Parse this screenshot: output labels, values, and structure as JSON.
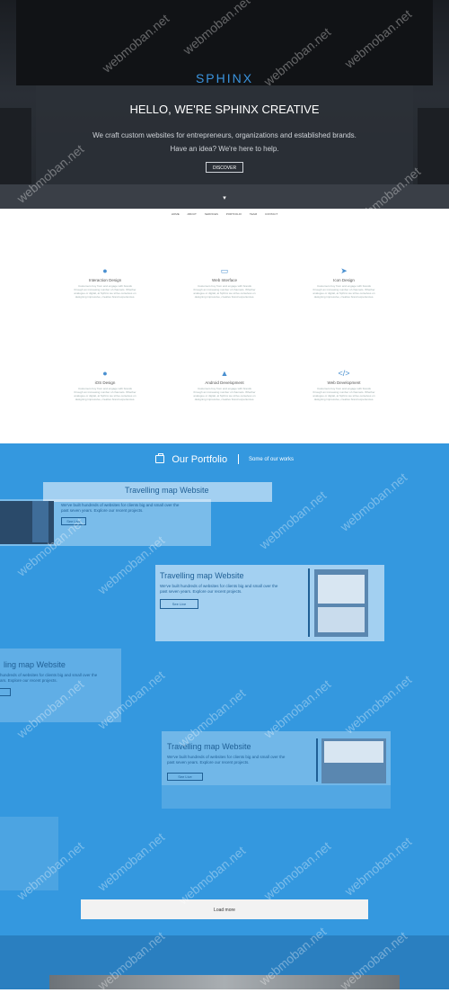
{
  "hero": {
    "logo": "SPHINX",
    "title": "HELLO, WE'RE SPHINX CREATIVE",
    "subtitle_line1": "We craft custom websites for entrepreneurs, organizations and established brands.",
    "subtitle_line2": "Have an idea? We're here to help.",
    "discover_label": "DISCOVER",
    "scroll_icon": "mouse-scroll-icon"
  },
  "nav": {
    "items": [
      "HOME",
      "ABOUT",
      "SERVICES",
      "PORTFOLIO",
      "TEAM",
      "CONTACT"
    ]
  },
  "services": [
    {
      "icon": "lightbulb-icon",
      "glyph": "💡",
      "title": "Interaction Design",
      "desc": "Customers buy from and engage with brands through an increasing number of channels. Whether analogue or digital, at Sphinx we strive ourselves on designing impressive, creative brand experiences."
    },
    {
      "icon": "monitor-icon",
      "glyph": "▭",
      "title": "Web Interface",
      "desc": "Customers buy from and engage with brands through an increasing number of channels. Whether analogue or digital, at Sphinx we strive ourselves on designing impressive, creative brand experiences."
    },
    {
      "icon": "rocket-icon",
      "glyph": "🚀",
      "title": "Icon Design",
      "desc": "Customers buy from and engage with brands through an increasing number of channels. Whether analogue or digital, at Sphinx we strive ourselves on designing impressive, creative brand experiences."
    },
    {
      "icon": "apple-icon",
      "glyph": "",
      "title": "iOS Design",
      "desc": "Customers buy from and engage with brands through an increasing number of channels. Whether analogue or digital, at Sphinx we strive ourselves on designing impressive, creative brand experiences."
    },
    {
      "icon": "android-icon",
      "glyph": "🤖",
      "title": "Android Development",
      "desc": "Customers buy from and engage with brands through an increasing number of channels. Whether analogue or digital, at Sphinx we strive ourselves on designing impressive, creative brand experiences."
    },
    {
      "icon": "code-icon",
      "glyph": "</>",
      "title": "Web Development",
      "desc": "Customers buy from and engage with brands through an increasing number of channels. Whether analogue or digital, at Sphinx we strive ourselves on designing impressive, creative brand experiences."
    }
  ],
  "portfolio": {
    "heading": "Our Portfolio",
    "subheading": "Some of our works",
    "icon": "briefcase-icon",
    "cards": [
      {
        "title": "Travelling map Website",
        "desc_line1": "We've built hundreds of websites for clients big and small over the",
        "desc_line2": "past seven years. Explore our recent projects.",
        "button": "See Live"
      },
      {
        "title": "Travelling map Website",
        "desc_line1": "We've built hundreds of websites for clients big and small over the",
        "desc_line2": "past seven years. Explore our recent projects.",
        "button": "See Live"
      },
      {
        "title": "ling map Website",
        "desc_line1": "hundreds of websites for clients big and small over the",
        "desc_line2": "ars. Explore our recent projects.",
        "button": ""
      },
      {
        "title": "Travelling map Website",
        "desc_line1": "We've built hundreds of websites for clients big and small over the",
        "desc_line2": "past seven years. Explore our recent projects.",
        "button": "See Live"
      }
    ],
    "load_more": "Load more"
  },
  "watermark": "webmoban.net",
  "colors": {
    "accent": "#3a93dd",
    "portfolio_bg": "#3498df",
    "hero_bg": "#1f2328"
  }
}
